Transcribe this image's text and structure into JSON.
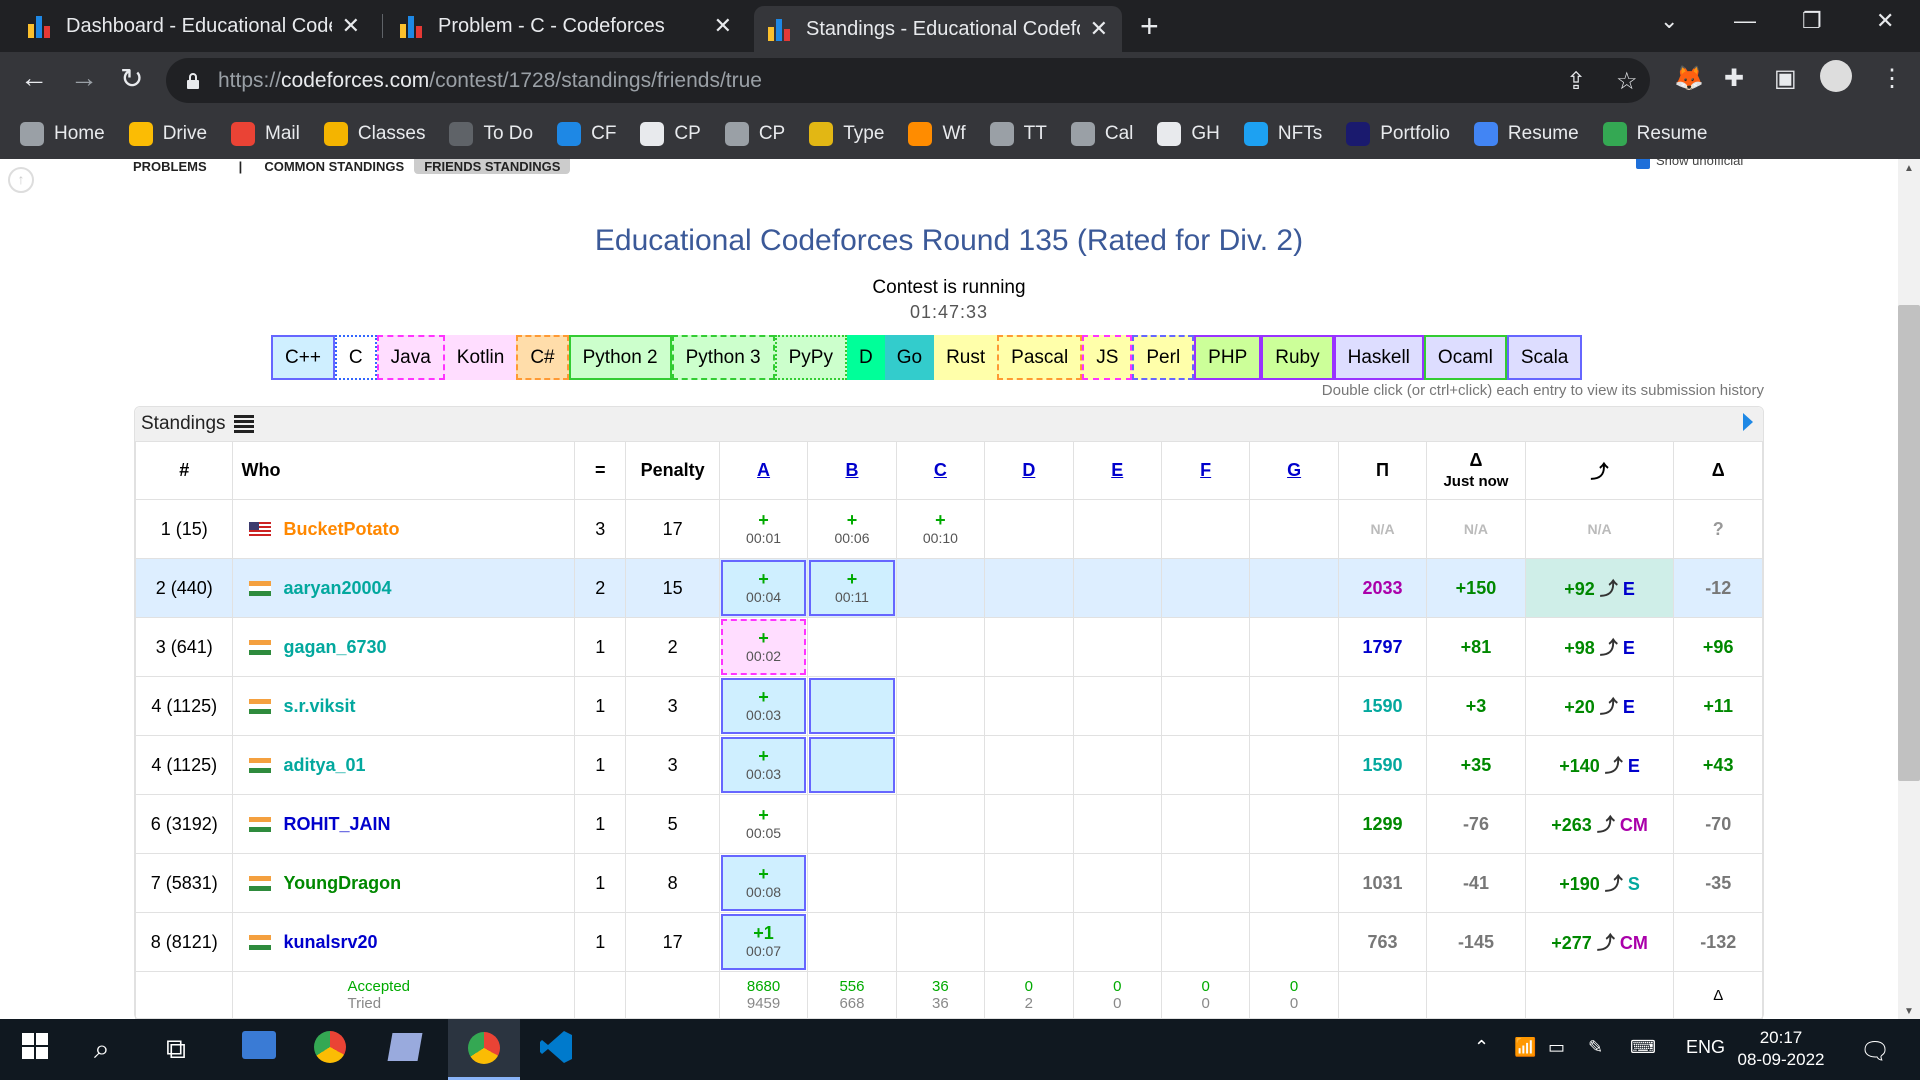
{
  "browser": {
    "tabs": [
      {
        "title": "Dashboard - Educational Codeforces Round 135"
      },
      {
        "title": "Problem - C - Codeforces"
      },
      {
        "title": "Standings - Educational Codeforces Round 135"
      }
    ],
    "url_prefix": "https://",
    "url_domain": "codeforces.com",
    "url_path": "/contest/1728/standings/friends/true",
    "bookmarks": [
      {
        "label": "Home",
        "icon": "globe-icon",
        "color": "#9aa0a6"
      },
      {
        "label": "Drive",
        "icon": "drive-icon",
        "color": "#fbbc04"
      },
      {
        "label": "Mail",
        "icon": "gmail-icon",
        "color": "#ea4335"
      },
      {
        "label": "Classes",
        "icon": "classroom-icon",
        "color": "#f4b400"
      },
      {
        "label": "To Do",
        "icon": "todo-icon",
        "color": "#5f6368"
      },
      {
        "label": "CF",
        "icon": "codeforces-icon",
        "color": "#1e88e5"
      },
      {
        "label": "CP",
        "icon": "github-icon",
        "color": "#e8eaed"
      },
      {
        "label": "CP",
        "icon": "checklist-icon",
        "color": "#9aa0a6"
      },
      {
        "label": "Type",
        "icon": "monkeytype-icon",
        "color": "#e2b714"
      },
      {
        "label": "Wf",
        "icon": "sun-icon",
        "color": "#ff8c00"
      },
      {
        "label": "TT",
        "icon": "globe-icon",
        "color": "#9aa0a6"
      },
      {
        "label": "Cal",
        "icon": "globe-icon",
        "color": "#9aa0a6"
      },
      {
        "label": "GH",
        "icon": "github-icon",
        "color": "#e8eaed"
      },
      {
        "label": "NFTs",
        "icon": "circle-icon",
        "color": "#1da1f2"
      },
      {
        "label": "Portfolio",
        "icon": "a-logo-icon",
        "color": "#1a1a6e"
      },
      {
        "label": "Resume",
        "icon": "docs-icon",
        "color": "#4285f4"
      },
      {
        "label": "Resume",
        "icon": "leaf-icon",
        "color": "#34a853"
      }
    ]
  },
  "page": {
    "submenu": [
      "PROBLEMS",
      "|",
      "COMMON STANDINGS",
      "FRIENDS STANDINGS"
    ],
    "show_unofficial": "Show unofficial",
    "contest_title": "Educational Codeforces Round 135 (Rated for Div. 2)",
    "status": "Contest is running",
    "timer": "01:47:33",
    "languages": [
      {
        "name": "C++",
        "border": "2px solid #66f",
        "bg": "#cfefff"
      },
      {
        "name": "C",
        "border": "2px dotted #36f",
        "bg": "#fff"
      },
      {
        "name": "Java",
        "border": "2px dashed #f3f",
        "bg": "#fdf"
      },
      {
        "name": "Kotlin",
        "border": "none",
        "bg": "#fdf"
      },
      {
        "name": "C#",
        "border": "2px dashed #f93",
        "bg": "#fda"
      },
      {
        "name": "Python 2",
        "border": "2px solid #3c3",
        "bg": "#cfc"
      },
      {
        "name": "Python 3",
        "border": "2px dashed #3c3",
        "bg": "#cfc"
      },
      {
        "name": "PyPy",
        "border": "2px dotted #3c3",
        "bg": "#cfc"
      },
      {
        "name": "D",
        "border": "none",
        "bg": "#0f9"
      },
      {
        "name": "Go",
        "border": "none",
        "bg": "#3cc"
      },
      {
        "name": "Rust",
        "border": "none",
        "bg": "#ffa"
      },
      {
        "name": "Pascal",
        "border": "2px dashed #f93",
        "bg": "#ffa"
      },
      {
        "name": "JS",
        "border": "2px dashed #f3f",
        "bg": "#ffa"
      },
      {
        "name": "Perl",
        "border": "2px dashed #66f",
        "bg": "#ffa"
      },
      {
        "name": "PHP",
        "border": "2px solid #93f",
        "bg": "#cf9"
      },
      {
        "name": "Ruby",
        "border": "2px solid #93f",
        "bg": "#cf9"
      },
      {
        "name": "Haskell",
        "border": "2px solid #93f",
        "bg": "#ddf"
      },
      {
        "name": "Ocaml",
        "border": "2px solid #3c3",
        "bg": "#ddf"
      },
      {
        "name": "Scala",
        "border": "2px solid #66f",
        "bg": "#ddf"
      }
    ],
    "hint": "Double click (or ctrl+click) each entry to view its submission history",
    "standings_label": "Standings",
    "headers": {
      "rank": "#",
      "who": "Who",
      "solved": "=",
      "penalty": "Penalty",
      "problems": [
        "A",
        "B",
        "C",
        "D",
        "E",
        "F",
        "G"
      ],
      "rating": "Π",
      "delta_just_now_symbol": "Δ",
      "delta_just_now": "Just now",
      "perf": "⤴",
      "delta": "Δ"
    },
    "rows": [
      {
        "rank": "1 (15)",
        "flag": "us",
        "who": "BucketPotato",
        "who_color": "#f80",
        "solved": "3",
        "penalty": "17",
        "hl": false,
        "cells": [
          {
            "r": "+",
            "t": "00:01"
          },
          {
            "r": "+",
            "t": "00:06"
          },
          {
            "r": "+",
            "t": "00:10"
          },
          null,
          null,
          null,
          null
        ],
        "rating": "N/A",
        "rating_color": "#bbb",
        "jn": "N/A",
        "jn_color": "#bbb",
        "perf": "N/A",
        "perf_rank": "",
        "perf_color": "#bbb",
        "delta": "?",
        "delta_color": "#999"
      },
      {
        "rank": "2 (440)",
        "flag": "in",
        "who": "aaryan20004",
        "who_color": "#03a89e",
        "solved": "2",
        "penalty": "15",
        "hl": true,
        "cells": [
          {
            "r": "+",
            "t": "00:04",
            "box": "cpp"
          },
          {
            "r": "+",
            "t": "00:11",
            "box": "cpp"
          },
          null,
          null,
          null,
          null,
          null
        ],
        "rating": "2033",
        "rating_color": "#a0a",
        "jn": "+150",
        "jn_color": "#080",
        "perf": "+92",
        "perf_rank": "E",
        "perf_color": "#080",
        "delta": "-12",
        "delta_color": "#777"
      },
      {
        "rank": "3 (641)",
        "flag": "in",
        "who": "gagan_6730",
        "who_color": "#03a89e",
        "solved": "1",
        "penalty": "2",
        "hl": false,
        "cells": [
          {
            "r": "+",
            "t": "00:02",
            "box": "java"
          },
          null,
          null,
          null,
          null,
          null,
          null
        ],
        "rating": "1797",
        "rating_color": "#00c",
        "jn": "+81",
        "jn_color": "#080",
        "perf": "+98",
        "perf_rank": "E",
        "perf_color": "#080",
        "delta": "+96",
        "delta_color": "#080"
      },
      {
        "rank": "4 (1125)",
        "flag": "in",
        "who": "s.r.viksit",
        "who_color": "#03a89e",
        "solved": "1",
        "penalty": "3",
        "hl": false,
        "cells": [
          {
            "r": "+",
            "t": "00:03",
            "box": "cpp"
          },
          {
            "r": "",
            "t": "",
            "box": "cpp"
          },
          null,
          null,
          null,
          null,
          null
        ],
        "rating": "1590",
        "rating_color": "#03a89e",
        "jn": "+3",
        "jn_color": "#080",
        "perf": "+20",
        "perf_rank": "E",
        "perf_color": "#080",
        "delta": "+11",
        "delta_color": "#080"
      },
      {
        "rank": "4 (1125)",
        "flag": "in",
        "who": "aditya_01",
        "who_color": "#03a89e",
        "solved": "1",
        "penalty": "3",
        "hl": false,
        "cells": [
          {
            "r": "+",
            "t": "00:03",
            "box": "cpp"
          },
          {
            "r": "",
            "t": "",
            "box": "cpp"
          },
          null,
          null,
          null,
          null,
          null
        ],
        "rating": "1590",
        "rating_color": "#03a89e",
        "jn": "+35",
        "jn_color": "#080",
        "perf": "+140",
        "perf_rank": "E",
        "perf_color": "#080",
        "delta": "+43",
        "delta_color": "#080"
      },
      {
        "rank": "6 (3192)",
        "flag": "in",
        "who": "ROHIT_JAIN",
        "who_color": "#00c",
        "solved": "1",
        "penalty": "5",
        "hl": false,
        "cells": [
          {
            "r": "+",
            "t": "00:05"
          },
          null,
          null,
          null,
          null,
          null,
          null
        ],
        "rating": "1299",
        "rating_color": "#080",
        "jn": "-76",
        "jn_color": "#777",
        "perf": "+263",
        "perf_rank": "CM",
        "perf_color": "#080",
        "delta": "-70",
        "delta_color": "#777"
      },
      {
        "rank": "7 (5831)",
        "flag": "in",
        "who": "YoungDragon",
        "who_color": "#080",
        "solved": "1",
        "penalty": "8",
        "hl": false,
        "cells": [
          {
            "r": "+",
            "t": "00:08",
            "box": "cpp"
          },
          null,
          null,
          null,
          null,
          null,
          null
        ],
        "rating": "1031",
        "rating_color": "#777",
        "jn": "-41",
        "jn_color": "#777",
        "perf": "+190",
        "perf_rank": "S",
        "perf_color": "#080",
        "delta": "-35",
        "delta_color": "#777"
      },
      {
        "rank": "8 (8121)",
        "flag": "in",
        "who": "kunalsrv20",
        "who_color": "#00c",
        "solved": "1",
        "penalty": "17",
        "hl": false,
        "cells": [
          {
            "r": "+1",
            "t": "00:07",
            "box": "cpp"
          },
          null,
          null,
          null,
          null,
          null,
          null
        ],
        "rating": "763",
        "rating_color": "#777",
        "jn": "-145",
        "jn_color": "#777",
        "perf": "+277",
        "perf_rank": "CM",
        "perf_color": "#080",
        "delta": "-132",
        "delta_color": "#777"
      }
    ],
    "footer": {
      "accepted_label": "Accepted",
      "tried_label": "Tried",
      "accepted": [
        "8680",
        "556",
        "36",
        "0",
        "0",
        "0",
        "0"
      ],
      "tried": [
        "9459",
        "668",
        "36",
        "2",
        "0",
        "0",
        "0"
      ],
      "delta_symbol": "Δ"
    }
  },
  "taskbar": {
    "time": "20:17",
    "date": "08-09-2022",
    "lang": "ENG"
  }
}
